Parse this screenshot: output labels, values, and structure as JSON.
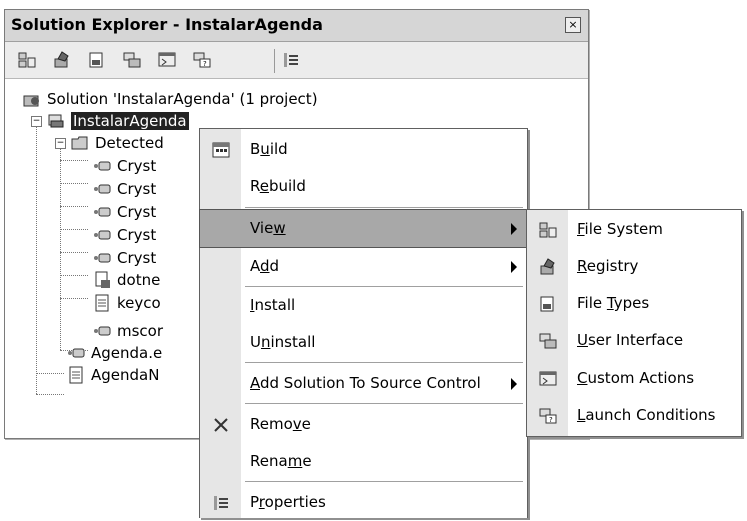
{
  "window": {
    "title": "Solution Explorer - InstalarAgenda",
    "close_glyph": "×",
    "toolbar_icons": [
      "file-system-icon",
      "registry-icon",
      "file-types-icon",
      "user-interface-icon",
      "custom-actions-icon",
      "launch-conditions-icon",
      "properties-icon"
    ]
  },
  "tree": {
    "solution": "Solution 'InstalarAgenda' (1 project)",
    "project": "InstalarAgenda",
    "detected": "Detected",
    "children": [
      "Cryst",
      "Cryst",
      "Cryst",
      "Cryst",
      "Cryst",
      "dotne",
      "keyco",
      "mscor"
    ],
    "agenda_e": "Agenda.e",
    "agenda_n": "AgendaN"
  },
  "context_menu": {
    "build": {
      "pre": "B",
      "u": "u",
      "post": "ild"
    },
    "rebuild": {
      "pre": "R",
      "u": "e",
      "post": "build"
    },
    "view": {
      "pre": "Vie",
      "u": "w",
      "post": ""
    },
    "add": {
      "pre": "A",
      "u": "d",
      "post": "d"
    },
    "install": {
      "pre": "",
      "u": "I",
      "post": "nstall"
    },
    "uninstall": {
      "pre": "U",
      "u": "n",
      "post": "install"
    },
    "add_source": {
      "pre": "",
      "u": "A",
      "post": "dd Solution To Source Control"
    },
    "remove": {
      "pre": "Remo",
      "u": "v",
      "post": "e"
    },
    "rename": {
      "pre": "Rena",
      "u": "m",
      "post": "e"
    },
    "properties": {
      "pre": "P",
      "u": "r",
      "post": "operties"
    }
  },
  "view_submenu": {
    "file_system": {
      "pre": "",
      "u": "F",
      "post": "ile System"
    },
    "registry": {
      "pre": "",
      "u": "R",
      "post": "egistry"
    },
    "file_types": {
      "pre": "File ",
      "u": "T",
      "post": "ypes"
    },
    "user_interface": {
      "pre": "",
      "u": "U",
      "post": "ser Interface"
    },
    "custom_actions": {
      "pre": "",
      "u": "C",
      "post": "ustom Actions"
    },
    "launch_conditions": {
      "pre": "",
      "u": "L",
      "post": "aunch Conditions"
    }
  }
}
